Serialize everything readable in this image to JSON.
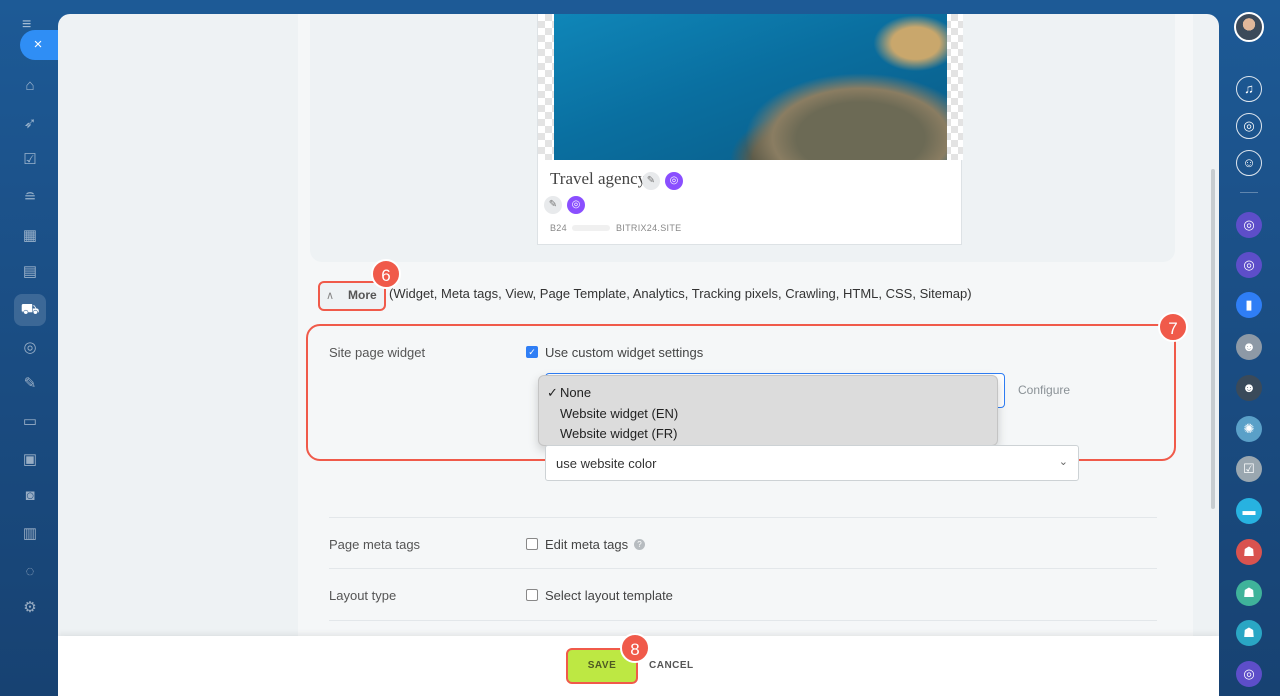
{
  "nav": {
    "close_symbol": "×",
    "menu_symbol": "≡",
    "icons": [
      "home-icon",
      "rocket-icon",
      "tasks-icon",
      "filter-icon",
      "calendar-icon",
      "briefcase-icon",
      "cart-icon",
      "copilot-icon",
      "pen-icon",
      "document-icon",
      "card-icon",
      "robot-icon",
      "chart-icon",
      "shield-icon",
      "settings-icon"
    ]
  },
  "site_card": {
    "title": "Travel agency",
    "domain_prefix": "B24",
    "domain": "BITRIX24.SITE"
  },
  "more": {
    "label": "More",
    "items_text": "(Widget, Meta tags, View, Page Template, Analytics, Tracking pixels, Crawling, HTML, CSS, Sitemap)"
  },
  "badges": {
    "more": "6",
    "widget": "7",
    "save": "8"
  },
  "widget": {
    "label": "Site page widget",
    "custom_settings_label": "Use custom widget settings",
    "custom_settings_checked": true,
    "configure_label": "Configure",
    "options": [
      {
        "label": "None",
        "selected": true
      },
      {
        "label": "Website widget (EN)",
        "selected": false
      },
      {
        "label": "Website widget (FR)",
        "selected": false
      }
    ],
    "check_mark": "✓",
    "color_value": "use website color"
  },
  "meta": {
    "label": "Page meta tags",
    "checkbox_label": "Edit meta tags",
    "help": "?"
  },
  "layout": {
    "label": "Layout type",
    "checkbox_label": "Select layout template"
  },
  "footer": {
    "save_label": "SAVE",
    "cancel_label": "CANCEL"
  },
  "colors": {
    "accent_blue": "#2f7ef5",
    "highlight_red": "#f05a4a",
    "save_green": "#bde843",
    "ai_purple": "#8a4fff"
  }
}
